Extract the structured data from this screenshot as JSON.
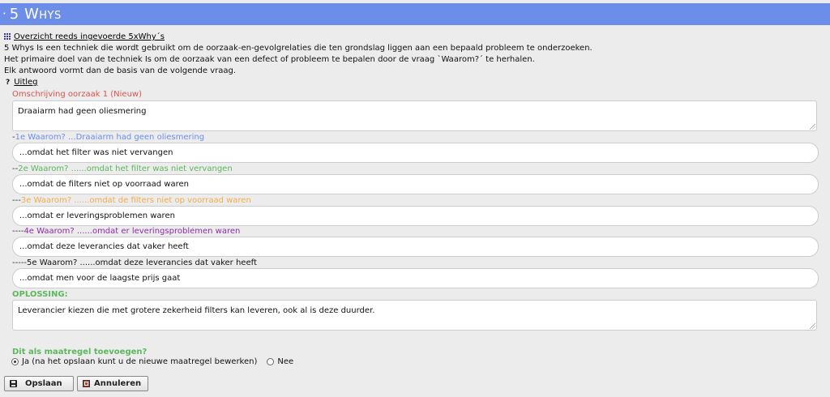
{
  "header": {
    "title": "5 Whys"
  },
  "overview_link": "Overzicht reeds ingevoerde 5xWhy´s",
  "intro": [
    "5 Whys Is een techniek die wordt gebruikt om de oorzaak-en-gevolgrelaties die ten grondslag liggen aan een bepaald probleem te onderzoeken.",
    "Het primaire doel van de techniek Is om de oorzaak van een defect of probleem te bepalen door de vraag `Waarom?´ te herhalen.",
    "Elk antwoord vormt dan de basis van de volgende vraag."
  ],
  "explain": {
    "icon": "?",
    "label": "Uitleg"
  },
  "cause": {
    "label": "Omschrijving oorzaak 1 (Nieuw)",
    "value": "Draaiarm had geen oliesmering"
  },
  "whys": [
    {
      "prefix": "-",
      "label": "1e Waarom? ...Draaiarm had geen oliesmering",
      "value": "...omdat het filter was niet vervangen"
    },
    {
      "prefix": "--",
      "label": "2e Waarom? ......omdat het filter was niet vervangen",
      "value": "...omdat de filters niet op voorraad waren"
    },
    {
      "prefix": "---",
      "label": "3e Waarom? ......omdat de filters niet op voorraad waren",
      "value": "...omdat er leveringsproblemen waren"
    },
    {
      "prefix": "----",
      "label": "4e Waarom? ......omdat er leveringsproblemen waren",
      "value": "...omdat deze leverancies dat vaker heeft"
    },
    {
      "prefix": "-----",
      "label": "5e Waarom? ......omdat deze leverancies dat vaker heeft",
      "value": "...omdat men voor de laagste prijs gaat"
    }
  ],
  "solution": {
    "label": "OPLOSSING:",
    "value": "Leverancier kiezen die met grotere zekerheid filters kan leveren, ook al is deze duurder."
  },
  "measure": {
    "question": "Dit als maatregel toevoegen?",
    "option_yes": "Ja (na het opslaan kunt u de nieuwe maatregel bewerken)",
    "option_no": "Nee",
    "selected": "yes"
  },
  "buttons": {
    "save": "Opslaan",
    "cancel": "Annuleren"
  },
  "colors": {
    "header_bg": "#6d8ee8",
    "cause_label": "#d9534f",
    "why1": "#6d8ee8",
    "why2": "#5cb85c",
    "why3": "#f0ad4e",
    "why4": "#8e2aa8",
    "why5": "#111111",
    "solution": "#5cb85c"
  }
}
